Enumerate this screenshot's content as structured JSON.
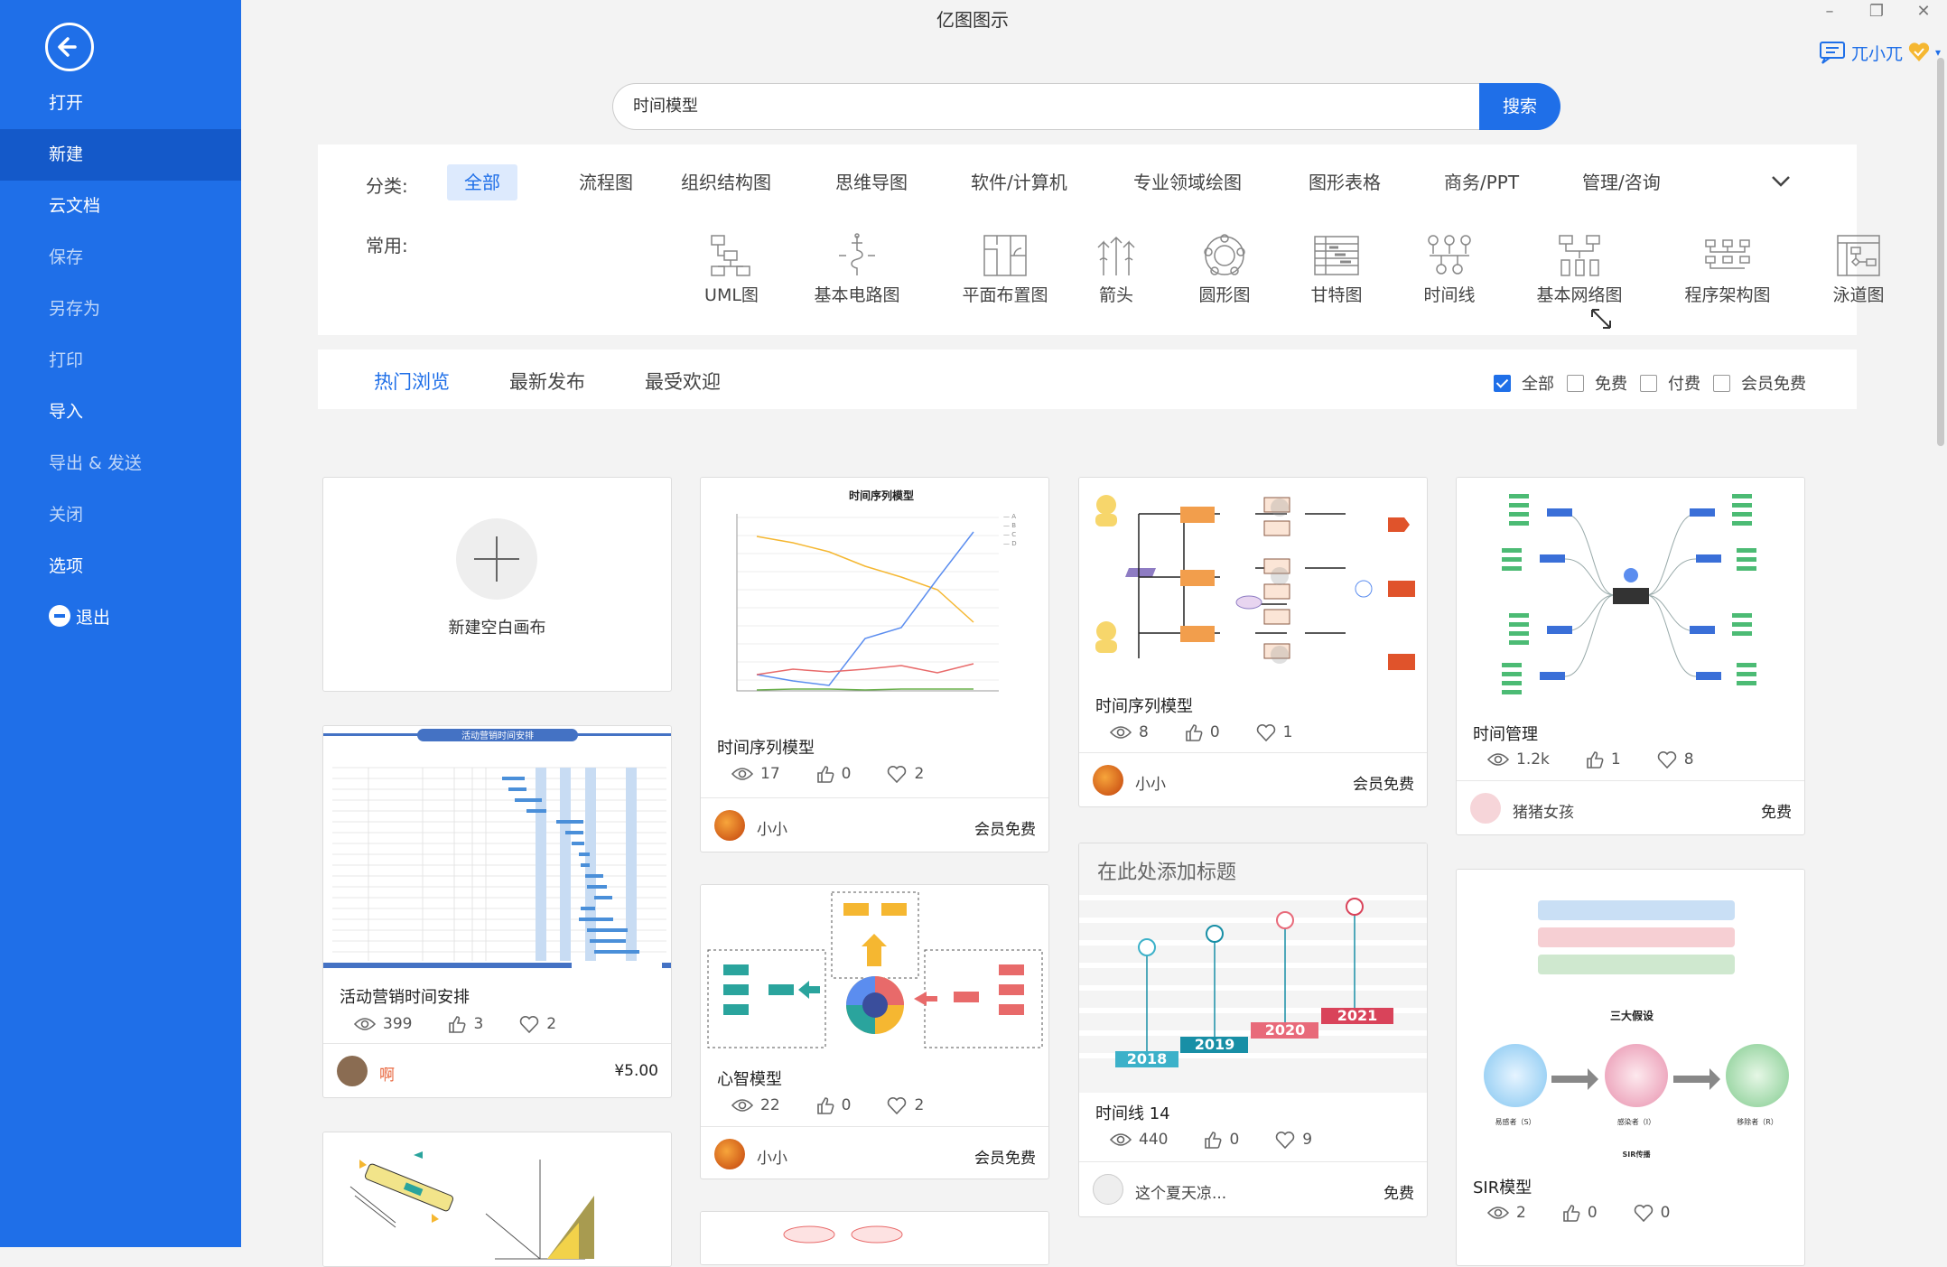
{
  "sidebar": {
    "items": [
      "打开",
      "新建",
      "云文档",
      "保存",
      "另存为",
      "打印",
      "导入",
      "导出 & 发送",
      "关闭",
      "选项",
      "退出"
    ]
  },
  "window": {
    "title": "亿图图示",
    "user": "兀小兀"
  },
  "search": {
    "value": "时间模型",
    "button": "搜索"
  },
  "categories": {
    "label": "分类:",
    "items": [
      "全部",
      "流程图",
      "组织结构图",
      "思维导图",
      "软件/计算机",
      "专业领域绘图",
      "图形表格",
      "商务/PPT",
      "管理/咨询"
    ]
  },
  "common": {
    "label": "常用:",
    "items": [
      "UML图",
      "基本电路图",
      "平面布置图",
      "箭头",
      "圆形图",
      "甘特图",
      "时间线",
      "基本网络图",
      "程序架构图",
      "泳道图"
    ]
  },
  "tabs": [
    "热门浏览",
    "最新发布",
    "最受欢迎"
  ],
  "price_filters": [
    {
      "label": "全部",
      "checked": true
    },
    {
      "label": "免费",
      "checked": false
    },
    {
      "label": "付费",
      "checked": false
    },
    {
      "label": "会员免费",
      "checked": false
    }
  ],
  "new_blank": {
    "label": "新建空白画布"
  },
  "cards": [
    {
      "title": "活动营销时间安排",
      "views": "399",
      "likes": "3",
      "favs": "2",
      "author": "啊",
      "price": "¥5.00",
      "thumb_heading": "活动营销时间安排"
    },
    {
      "title": "时间序列模型",
      "views": "17",
      "likes": "0",
      "favs": "2",
      "author": "小小",
      "price": "会员免费",
      "thumb_heading": "时间序列模型"
    },
    {
      "title": "心智模型",
      "views": "22",
      "likes": "0",
      "favs": "2",
      "author": "小小",
      "price": "会员免费"
    },
    {
      "title": "时间序列模型",
      "views": "8",
      "likes": "0",
      "favs": "1",
      "author": "小小",
      "price": "会员免费"
    },
    {
      "title": "时间线 14",
      "views": "440",
      "likes": "0",
      "favs": "9",
      "author": "这个夏天凉...",
      "price": "免费",
      "thumb_heading": "在此处添加标题",
      "years": [
        "2018",
        "2019",
        "2020",
        "2021"
      ]
    },
    {
      "title": "时间管理",
      "views": "1.2k",
      "likes": "1",
      "favs": "8",
      "author": "猪猪女孩",
      "price": "免费"
    },
    {
      "title": "SIR模型",
      "views": "2",
      "likes": "0",
      "favs": "0",
      "thumb_heading": "三大假设",
      "sir": [
        "易感者（S）",
        "感染者（I）",
        "移除者（R）"
      ],
      "sir_caption": "SIR传播"
    }
  ],
  "colors": {
    "brand": "#1f6fe8",
    "sidebar_active": "#1459c9"
  }
}
